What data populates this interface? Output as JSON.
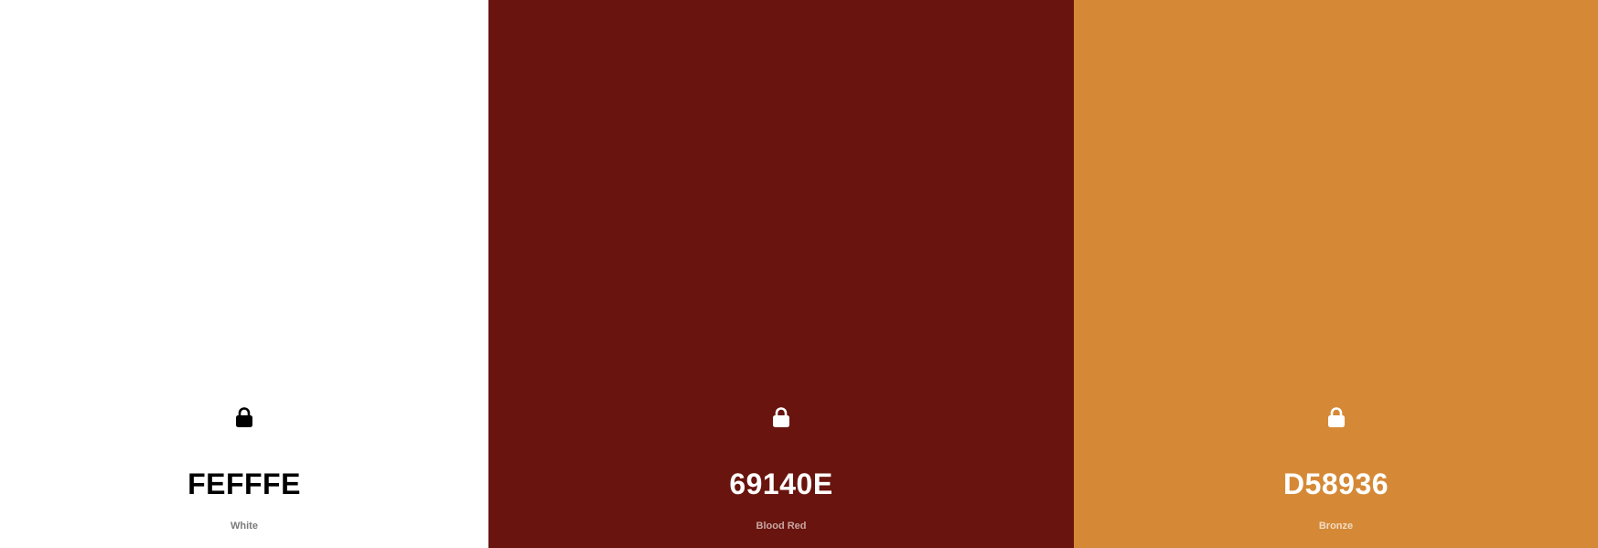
{
  "palette": {
    "swatches": [
      {
        "hex": "FEFFFE",
        "name": "White",
        "color": "#FEFFFE",
        "text_color": "#000000",
        "name_color": "#7a7a7a",
        "icon": "lock-icon"
      },
      {
        "hex": "69140E",
        "name": "Blood Red",
        "color": "#69140E",
        "text_color": "#FFFFFF",
        "name_color": "#c9a6a3",
        "icon": "lock-icon"
      },
      {
        "hex": "D58936",
        "name": "Bronze",
        "color": "#D58936",
        "text_color": "#FFFFFF",
        "name_color": "#f3dcc2",
        "icon": "lock-icon"
      }
    ]
  }
}
